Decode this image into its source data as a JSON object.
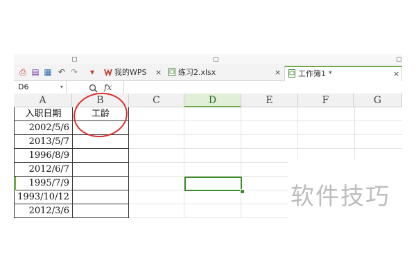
{
  "toolbar": {
    "tabs": [
      {
        "label": "我的WPS",
        "close": "×",
        "active": false
      },
      {
        "label": "练习2.xlsx",
        "close": "×",
        "active": false
      },
      {
        "label": "工作簿1 *",
        "close": "×",
        "active": true
      }
    ]
  },
  "formula_bar": {
    "name_box": "D6",
    "name_arrow": "▾",
    "zoom_icon": "magnifier-icon",
    "fx_label": "fx"
  },
  "sheet": {
    "columns": [
      "A",
      "B",
      "C",
      "D",
      "E",
      "F",
      "G"
    ],
    "active_column": "D",
    "rows": [
      {
        "A": "入职日期",
        "B": "工龄"
      },
      {
        "A": "2002/5/6",
        "B": ""
      },
      {
        "A": "2013/5/7",
        "B": ""
      },
      {
        "A": "1996/8/9",
        "B": ""
      },
      {
        "A": "2012/6/7",
        "B": ""
      },
      {
        "A": "1995/7/9",
        "B": ""
      },
      {
        "A": "1993/10/12",
        "B": ""
      },
      {
        "A": "2012/3/6",
        "B": ""
      }
    ]
  },
  "watermark": {
    "text": "软件技巧"
  },
  "colors": {
    "accent": "#6fa84f",
    "selection": "#3d8c2a",
    "annotation": "#d9302e"
  }
}
